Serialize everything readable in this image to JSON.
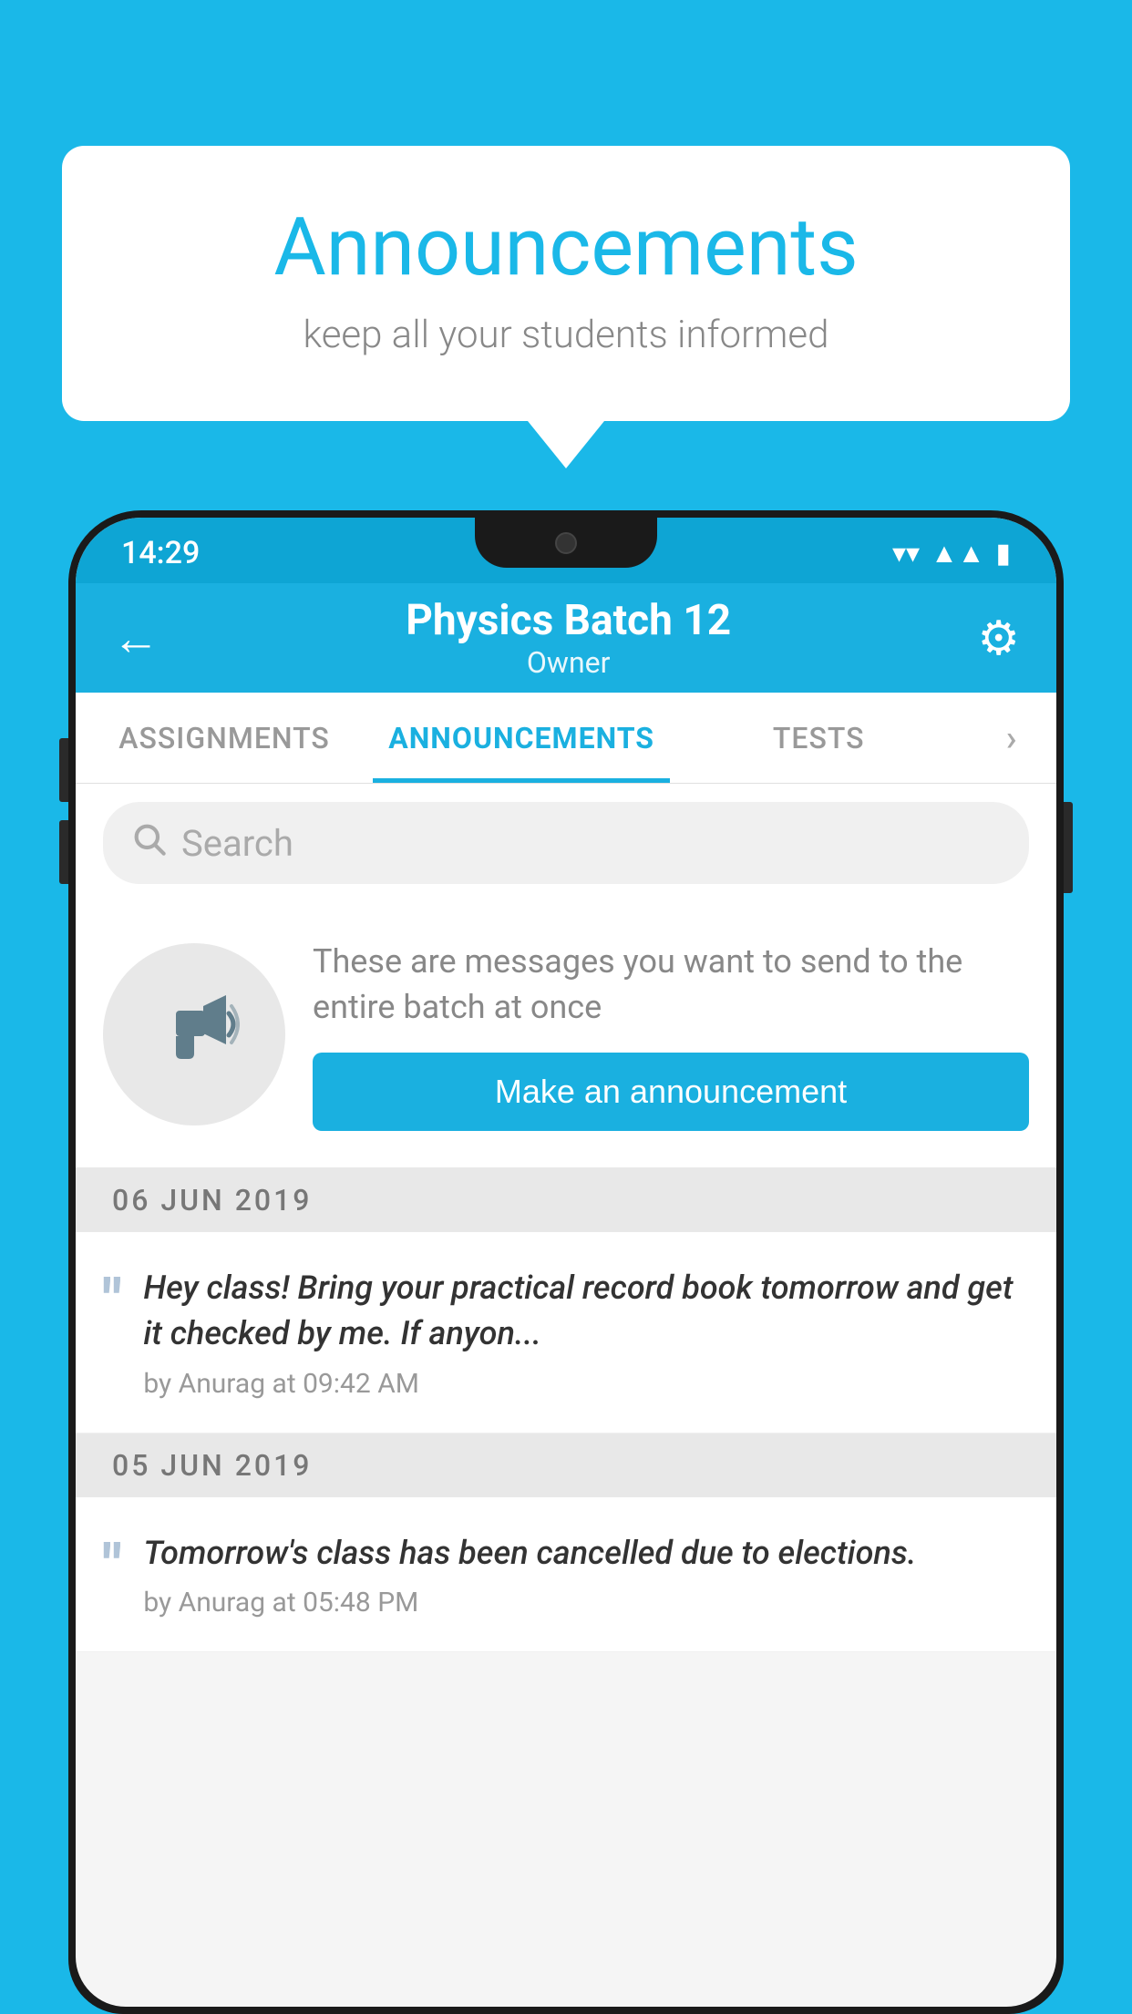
{
  "background_color": "#1ab8e8",
  "speech_bubble": {
    "title": "Announcements",
    "subtitle": "keep all your students informed"
  },
  "phone": {
    "status_bar": {
      "time": "14:29",
      "wifi": "▼",
      "signal": "▲",
      "battery": "▮"
    },
    "header": {
      "title": "Physics Batch 12",
      "subtitle": "Owner",
      "back_label": "←",
      "gear_label": "⚙"
    },
    "tabs": [
      {
        "label": "ASSIGNMENTS",
        "active": false
      },
      {
        "label": "ANNOUNCEMENTS",
        "active": true
      },
      {
        "label": "TESTS",
        "active": false
      },
      {
        "label": "›",
        "active": false
      }
    ],
    "search": {
      "placeholder": "Search"
    },
    "promo": {
      "description": "These are messages you want to send to the entire batch at once",
      "button_label": "Make an announcement"
    },
    "announcements": [
      {
        "date": "06  JUN  2019",
        "message": "Hey class! Bring your practical record book tomorrow and get it checked by me. If anyon...",
        "meta": "by Anurag at 09:42 AM"
      },
      {
        "date": "05  JUN  2019",
        "message": "Tomorrow's class has been cancelled due to elections.",
        "meta": "by Anurag at 05:48 PM"
      }
    ]
  }
}
